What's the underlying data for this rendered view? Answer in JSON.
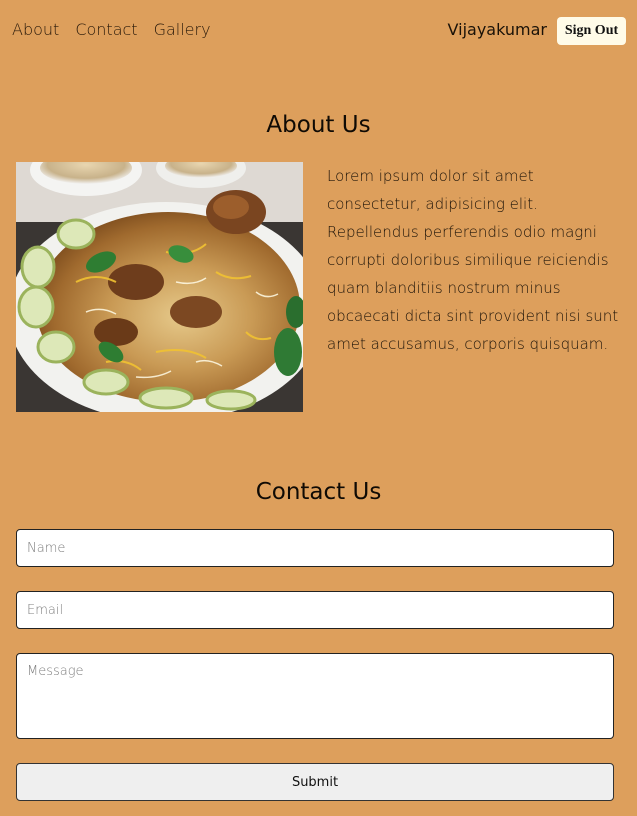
{
  "nav": {
    "links": [
      "About",
      "Contact",
      "Gallery"
    ],
    "user_name": "Vijayakumar",
    "signout_label": "Sign Out"
  },
  "about": {
    "title": "About Us",
    "image_alt": "biryani plate",
    "text": "Lorem ipsum dolor sit amet consectetur, adipisicing elit. Repellendus perferendis odio magni corrupti doloribus similique reiciendis quam blanditiis nostrum minus obcaecati dicta sint provident nisi sunt amet accusamus, corporis quisquam."
  },
  "contact": {
    "title": "Contact Us",
    "name_placeholder": "Name",
    "name_value": "",
    "email_placeholder": "Email",
    "email_value": "",
    "message_placeholder": "Message",
    "message_value": "",
    "submit_label": "Submit"
  },
  "colors": {
    "background": "#dd9f5c",
    "signout_bg": "#fffbe8",
    "submit_bg": "#efefef"
  }
}
